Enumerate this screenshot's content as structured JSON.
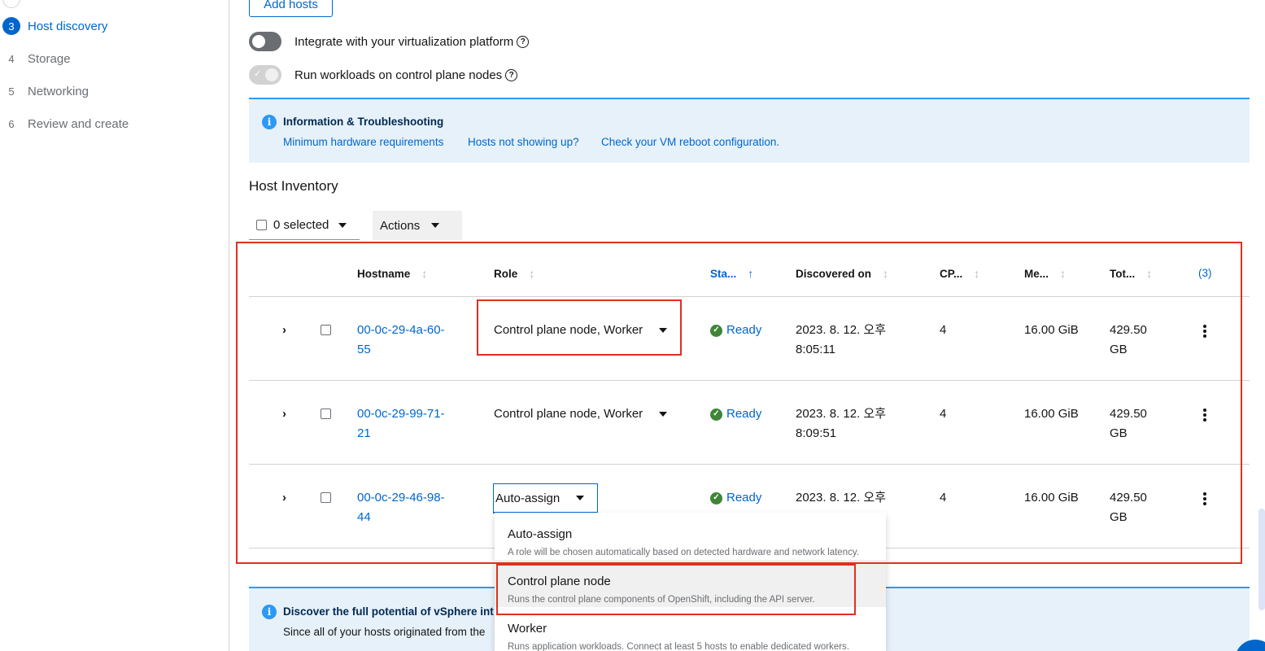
{
  "wizard": {
    "steps": [
      {
        "num": "3",
        "label": "Host discovery",
        "active": true
      },
      {
        "num": "4",
        "label": "Storage"
      },
      {
        "num": "5",
        "label": "Networking"
      },
      {
        "num": "6",
        "label": "Review and create"
      }
    ]
  },
  "header": {
    "add_hosts_label": "Add hosts",
    "toggles": [
      {
        "label": "Integrate with your virtualization platform",
        "state": "off"
      },
      {
        "label": "Run workloads on control plane nodes",
        "state": "on-disabled"
      }
    ]
  },
  "info_alert": {
    "title": "Information & Troubleshooting",
    "links": [
      "Minimum hardware requirements",
      "Hosts not showing up?",
      "Check your VM reboot configuration."
    ]
  },
  "inventory": {
    "title": "Host Inventory",
    "selected_label": "0 selected",
    "actions_label": "Actions",
    "columns": [
      "Hostname",
      "Role",
      "Sta...",
      "Discovered on",
      "CP...",
      "Me...",
      "Tot...",
      "(3)"
    ],
    "rows": [
      {
        "hostname_l1": "00-0c-29-4a-60-",
        "hostname_l2": "55",
        "role": "Control plane node, Worker",
        "status": "Ready",
        "discovered_l1": "2023. 8. 12. 오후",
        "discovered_l2": "8:05:11",
        "cpu": "4",
        "memory": "16.00 GiB",
        "total_l1": "429.50",
        "total_l2": "GB"
      },
      {
        "hostname_l1": "00-0c-29-99-71-",
        "hostname_l2": "21",
        "role": "Control plane node, Worker",
        "status": "Ready",
        "discovered_l1": "2023. 8. 12. 오후",
        "discovered_l2": "8:09:51",
        "cpu": "4",
        "memory": "16.00 GiB",
        "total_l1": "429.50",
        "total_l2": "GB"
      },
      {
        "hostname_l1": "00-0c-29-46-98-",
        "hostname_l2": "44",
        "role": "Auto-assign",
        "status": "Ready",
        "discovered_l1": "2023. 8. 12. 오후",
        "discovered_l2": "",
        "cpu": "4",
        "memory": "16.00 GiB",
        "total_l1": "429.50",
        "total_l2": "GB"
      }
    ]
  },
  "role_menu": {
    "options": [
      {
        "title": "Auto-assign",
        "desc": "A role will be chosen automatically based on detected hardware and network latency."
      },
      {
        "title": "Control plane node",
        "desc": "Runs the control plane components of OpenShift, including the API server."
      },
      {
        "title": "Worker",
        "desc": "Runs application workloads. Connect at least 5 hosts to enable dedicated workers."
      }
    ]
  },
  "vsphere_alert": {
    "title": "Discover the full potential of vSphere int",
    "text": "Since all of your hosts originated from the"
  },
  "colors": {
    "accent": "#0066cc",
    "success": "#3e8635",
    "highlight": "#e0301e",
    "info_bg": "#e7f1fa"
  }
}
